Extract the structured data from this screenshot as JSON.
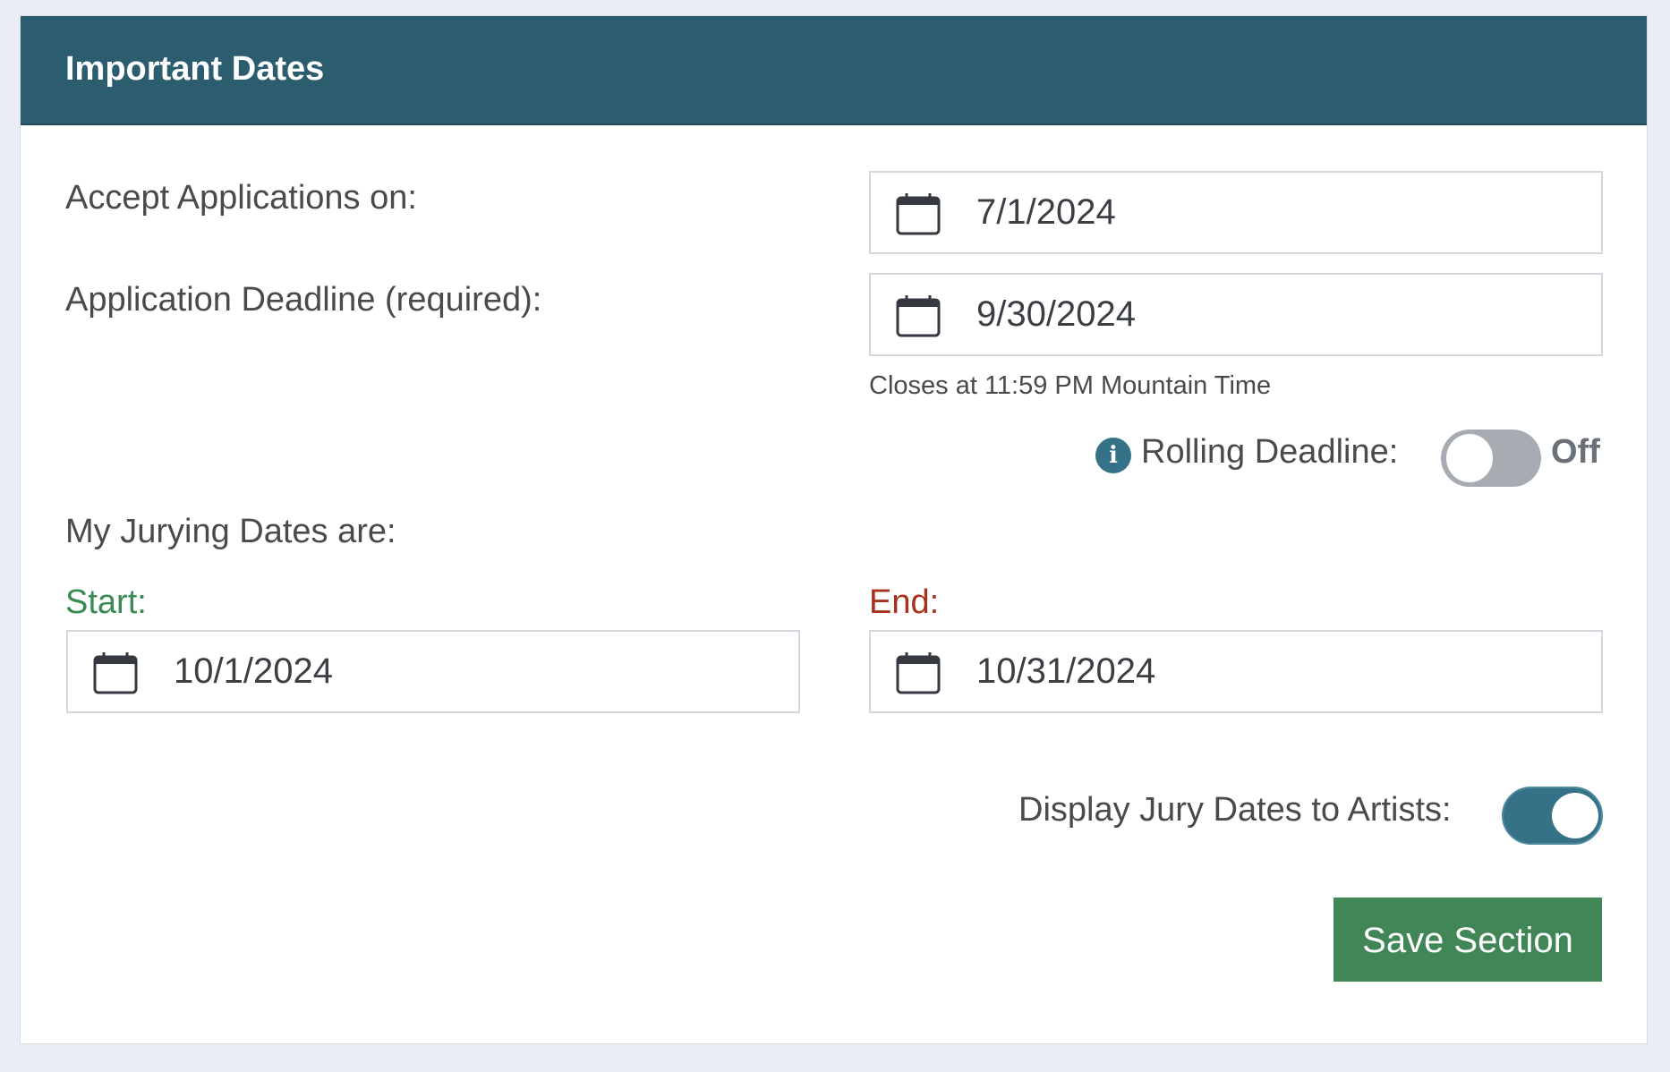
{
  "card": {
    "title": "Important Dates"
  },
  "fields": {
    "accept_applications": {
      "label": "Accept Applications on:",
      "value": "7/1/2024",
      "icon": "calendar-icon"
    },
    "application_deadline": {
      "label": "Application Deadline (required):",
      "value": "9/30/2024",
      "icon": "calendar-icon",
      "help_text": "Closes at 11:59 PM Mountain Time"
    },
    "rolling_deadline": {
      "label": "Rolling Deadline:",
      "state": "Off",
      "enabled": false,
      "icon": "info-icon"
    },
    "jurying": {
      "heading": "My Jurying Dates are:",
      "start": {
        "label": "Start:",
        "value": "10/1/2024",
        "icon": "calendar-icon",
        "color": "#3a8a55"
      },
      "end": {
        "label": "End:",
        "value": "10/31/2024",
        "icon": "calendar-icon",
        "color": "#a8321e"
      }
    },
    "display_jury_dates": {
      "label": "Display Jury Dates to Artists:",
      "enabled": true
    }
  },
  "actions": {
    "save_label": "Save Section"
  },
  "colors": {
    "header_bg": "#2c5d6f",
    "toggle_on": "#357288",
    "toggle_off": "#a7acb2",
    "save_button": "#418656"
  }
}
